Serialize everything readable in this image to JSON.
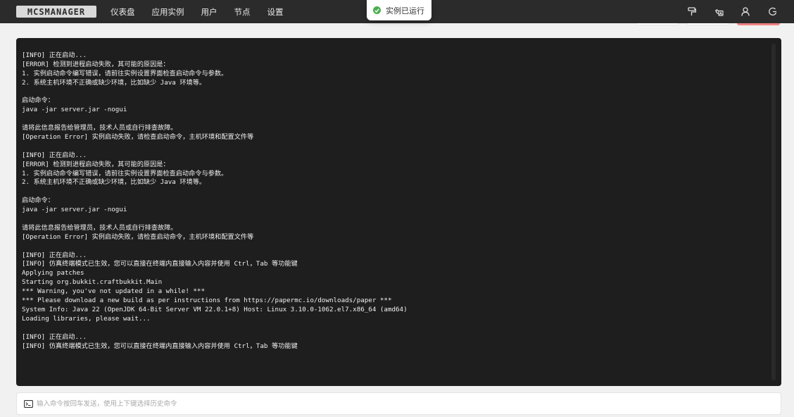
{
  "header": {
    "logo": "MCSMANAGER",
    "nav": [
      "仪表盘",
      "应用实例",
      "用户",
      "节点",
      "设置"
    ],
    "icons": [
      "brush-icon",
      "language-icon",
      "user-icon",
      "logout-icon"
    ]
  },
  "toast": {
    "text": "实例已运行",
    "icon": "check-circle-icon",
    "color": "#4caf50"
  },
  "terminal": {
    "lines": [
      "[INFO] 正在启动...",
      "[ERROR] 检测到进程启动失败，其可能的原因是：",
      "1. 实例启动命令编写错误，请前往实例设置界面检查启动命令与参数。",
      "2. 系统主机环境不正确或缺少环境，比如缺少 Java 环境等。",
      "",
      "启动命令：",
      "java -jar server.jar -nogui",
      "",
      "请将此信息报告给管理员，技术人员或自行排查故障。",
      "[Operation Error] 实例启动失败，请检查启动命令，主机环境和配置文件等",
      "",
      "[INFO] 正在启动...",
      "[ERROR] 检测到进程启动失败，其可能的原因是：",
      "1. 实例启动命令编写错误，请前往实例设置界面检查启动命令与参数。",
      "2. 系统主机环境不正确或缺少环境，比如缺少 Java 环境等。",
      "",
      "启动命令：",
      "java -jar server.jar -nogui",
      "",
      "请将此信息报告给管理员，技术人员或自行排查故障。",
      "[Operation Error] 实例启动失败，请检查启动命令，主机环境和配置文件等",
      "",
      "[INFO] 正在启动...",
      "[INFO] 仿真终端模式已生效，您可以直接在终端内直接输入内容并使用 Ctrl，Tab 等功能键",
      "Applying patches",
      "Starting org.bukkit.craftbukkit.Main",
      "*** Warning, you've not updated in a while! ***",
      "*** Please download a new build as per instructions from https://papermc.io/downloads/paper ***",
      "System Info: Java 22 (OpenJDK 64-Bit Server VM 22.0.1+8) Host: Linux 3.10.0-1062.el7.x86_64 (amd64)",
      "Loading libraries, please wait...",
      "",
      "[INFO] 正在启动...",
      "[INFO] 仿真终端模式已生效，您可以直接在终端内直接输入内容并使用 Ctrl，Tab 等功能键"
    ]
  },
  "command": {
    "placeholder": "输入命令按回车发送，使用上下键选择历史命令",
    "icon": "terminal-icon"
  }
}
